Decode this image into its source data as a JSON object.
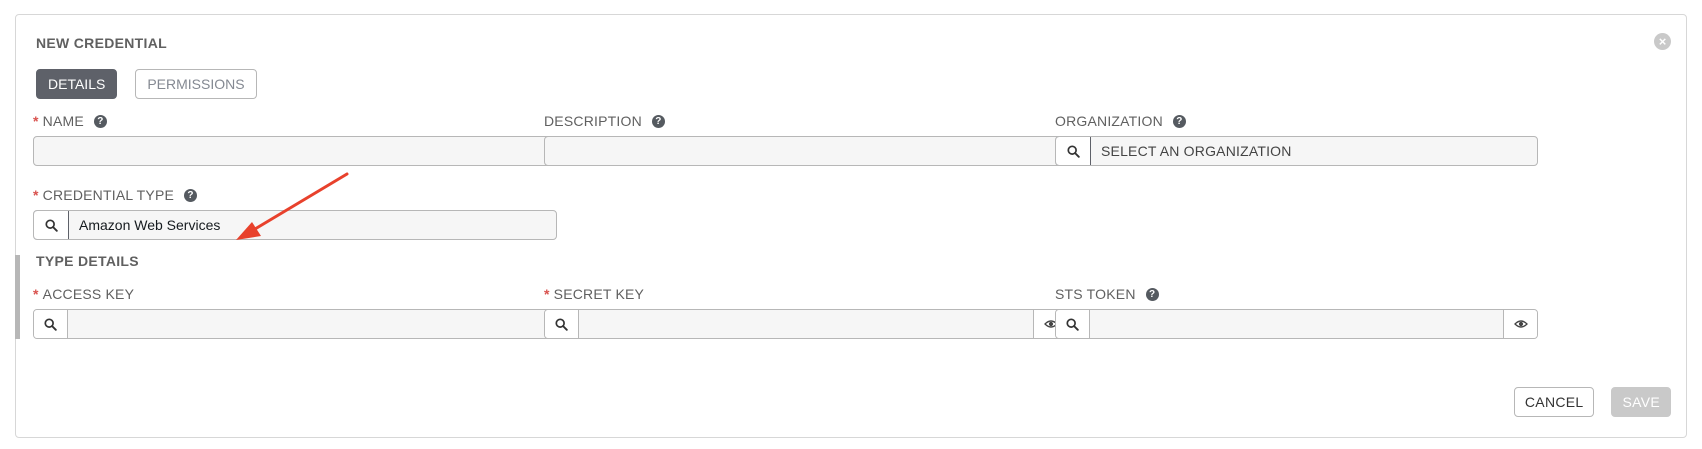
{
  "form": {
    "title": "NEW CREDENTIAL",
    "close_icon": "×"
  },
  "tabs": [
    {
      "label": "DETAILS",
      "active": true
    },
    {
      "label": "PERMISSIONS",
      "active": false
    }
  ],
  "fields": {
    "name": {
      "label": "NAME",
      "required": true,
      "value": ""
    },
    "description": {
      "label": "DESCRIPTION",
      "required": false,
      "value": ""
    },
    "organization": {
      "label": "ORGANIZATION",
      "required": false,
      "value": "SELECT AN ORGANIZATION"
    },
    "credential_type": {
      "label": "CREDENTIAL TYPE",
      "required": true,
      "value": "Amazon Web Services"
    }
  },
  "type_details": {
    "title": "TYPE DETAILS",
    "access_key": {
      "label": "ACCESS KEY",
      "required": true,
      "value": ""
    },
    "secret_key": {
      "label": "SECRET KEY",
      "required": true,
      "value": ""
    },
    "sts_token": {
      "label": "STS TOKEN",
      "required": false,
      "value": ""
    }
  },
  "actions": {
    "cancel": "CANCEL",
    "save": "SAVE"
  },
  "annotation": {
    "arrow_color": "#e8412c"
  },
  "colors": {
    "required": "#d9534f",
    "active_tab": "#5e6169",
    "save_disabled": "#c9c9c9"
  }
}
